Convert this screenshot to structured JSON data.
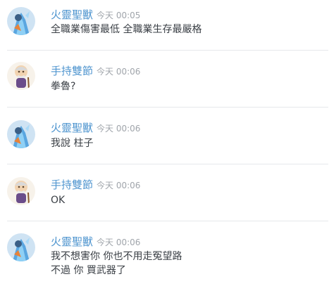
{
  "messages": [
    {
      "author": "火靈聖獸",
      "time": "今天 00:05",
      "avatar_icon": "blue-fire-beast-avatar",
      "lines": [
        "全職業傷害最低 全職業生存最嚴格"
      ]
    },
    {
      "author": "手持雙節",
      "time": "今天 00:06",
      "avatar_icon": "old-man-with-cane-avatar",
      "lines": [
        "拳魯?"
      ]
    },
    {
      "author": "火靈聖獸",
      "time": "今天 00:06",
      "avatar_icon": "blue-fire-beast-avatar",
      "lines": [
        "我說 柱子"
      ]
    },
    {
      "author": "手持雙節",
      "time": "今天 00:06",
      "avatar_icon": "old-man-with-cane-avatar",
      "lines": [
        "OK"
      ]
    },
    {
      "author": "火靈聖獸",
      "time": "今天 00:06",
      "avatar_icon": "blue-fire-beast-avatar",
      "lines": [
        "我不想害你 你也不用走冤望路",
        "不過 你 買武器了"
      ]
    }
  ],
  "colors": {
    "username": "#4f95cf",
    "timestamp": "#a0a5ab",
    "body_text": "#3a3f45",
    "divider": "#e6e8eb"
  }
}
